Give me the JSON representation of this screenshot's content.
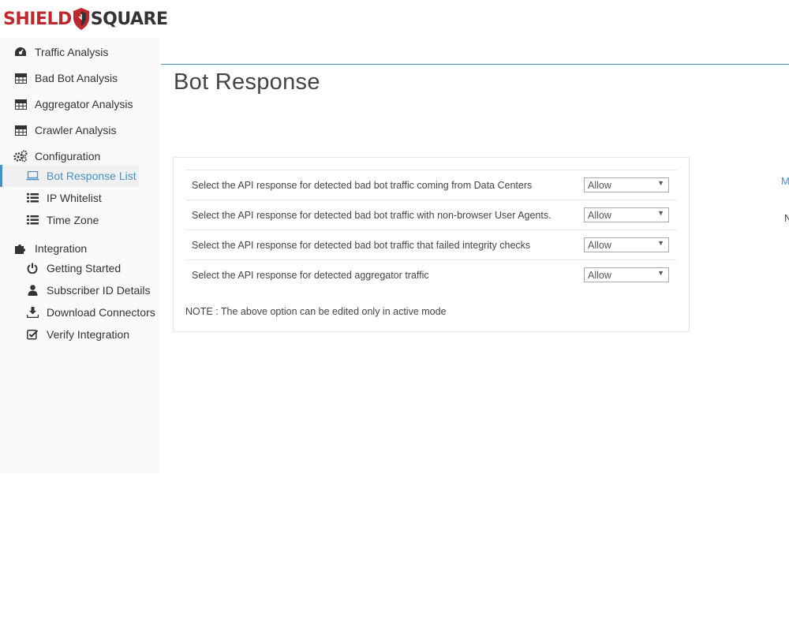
{
  "logo": {
    "part1": "SHIELD",
    "part2": "SQUARE",
    "colors": {
      "brand_red": "#c0282e",
      "text_dark": "#333333"
    }
  },
  "sidebar": {
    "items": [
      {
        "label": "Traffic Analysis",
        "icon": "dashboard-icon"
      },
      {
        "label": "Bad Bot Analysis",
        "icon": "table-icon"
      },
      {
        "label": "Aggregator Analysis",
        "icon": "table-icon"
      },
      {
        "label": "Crawler Analysis",
        "icon": "table-icon"
      },
      {
        "label": "Configuration",
        "icon": "gears-icon",
        "children": [
          {
            "label": "Bot Response List",
            "icon": "laptop-icon",
            "active": true
          },
          {
            "label": "IP Whitelist",
            "icon": "list-icon"
          },
          {
            "label": "Time Zone",
            "icon": "list-icon"
          }
        ]
      },
      {
        "label": "Integration",
        "icon": "puzzle-icon",
        "children": [
          {
            "label": "Getting Started",
            "icon": "power-icon"
          },
          {
            "label": "Subscriber ID Details",
            "icon": "user-icon"
          },
          {
            "label": "Download Connectors",
            "icon": "download-icon"
          },
          {
            "label": "Verify Integration",
            "icon": "check-square-icon"
          }
        ]
      }
    ]
  },
  "main": {
    "title": "Bot Response",
    "rows": [
      {
        "label": "Select the API response for detected bad bot traffic coming from Data Centers",
        "value": "Allow"
      },
      {
        "label": "Select the API response for detected bad bot traffic with non-browser User Agents.",
        "value": "Allow"
      },
      {
        "label": "Select the API response for detected bad bot traffic that failed integrity checks",
        "value": "Allow"
      },
      {
        "label": "Select the API response for detected aggregator traffic",
        "value": "Allow"
      }
    ],
    "note": "NOTE : The above option can be edited only in active mode",
    "edge_link": "M",
    "edge_text": "N"
  },
  "colors": {
    "accent": "#4a90c8",
    "sidebar_bg": "#fafafa",
    "border": "#e6e6e6"
  }
}
